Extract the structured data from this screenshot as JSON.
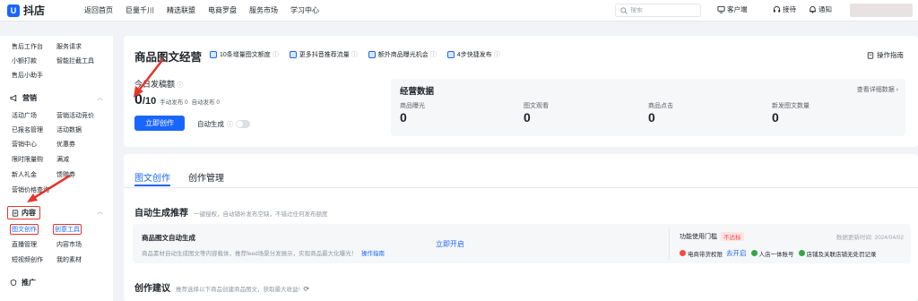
{
  "brand": {
    "logo_glyph": "U",
    "name": "抖店"
  },
  "topnav": [
    "返回首页",
    "巨量千川",
    "精选联盟",
    "电商罗盘",
    "服务市场",
    "学习中心"
  ],
  "search": {
    "placeholder": "搜索"
  },
  "toolbar": {
    "service": "客户端",
    "support": "接待",
    "notify": "通知"
  },
  "sidebar": {
    "top_rows": [
      [
        "售后工作台",
        "服务请求"
      ],
      [
        "小额打款",
        "智能拦截工具"
      ],
      [
        "售后小助手",
        ""
      ]
    ],
    "marketing": {
      "title": "营销",
      "rows": [
        [
          "活动广场",
          "营销活动竞价"
        ],
        [
          "已报名管理",
          "活动数据"
        ],
        [
          "营销中心",
          "优惠券"
        ],
        [
          "限时限量购",
          "满减"
        ],
        [
          "新人礼金",
          "馈赠券"
        ],
        [
          "营销价格查询",
          ""
        ]
      ]
    },
    "content": {
      "title": "内容",
      "rows": [
        [
          "图文创作",
          "创意工具"
        ],
        [
          "直播管理",
          "内容市场"
        ],
        [
          "短视频创作",
          "我的素材"
        ]
      ]
    },
    "promo": {
      "title": "推广"
    }
  },
  "header": {
    "title": "商品图文经营",
    "badges": [
      "10条增量图文额度",
      "更多抖音推荐流量",
      "额外商品曝光机会",
      "4步快捷发布"
    ],
    "guide": "操作指南"
  },
  "quota": {
    "label": "今日发稿额",
    "used": "0",
    "total": "/10",
    "manual": "手动发布 0",
    "auto": "自动发布 0",
    "create_btn": "立即创作",
    "auto_gen": "自动生成"
  },
  "business": {
    "title": "经营数据",
    "more": "查看详细数据",
    "metrics": [
      {
        "label": "商品曝光",
        "value": "0"
      },
      {
        "label": "图文观看",
        "value": "0"
      },
      {
        "label": "商品点击",
        "value": "0"
      },
      {
        "label": "新发图文数量",
        "value": "0"
      }
    ]
  },
  "tabs": {
    "active": "图文创作",
    "other": "创作管理"
  },
  "auto_section": {
    "title": "自动生成推荐",
    "desc": "一键授权，自动铺补发布空缺，不错过任何发布额度",
    "card_title": "商品图文自动生成",
    "card_desc": "商品素材自动生成图文等内容载体，推荐feed场景分发展示，实现商品最大化曝光！",
    "card_guide": "操作指南",
    "open_link": "立即开启",
    "threshold_label": "功能使用门槛",
    "threshold_status": "不达标",
    "update_time": "数据更新时间: 2024/04/02",
    "checks": [
      {
        "text": "电商带货权限",
        "ok": false,
        "action": "去开启"
      },
      {
        "text": "人店一体账号",
        "ok": true,
        "action": ""
      },
      {
        "text": "店铺及关联店铺无处罚记录",
        "ok": true,
        "action": ""
      }
    ]
  },
  "suggest": {
    "title": "创作建议",
    "desc": "推荐选择以下商品创建商品图文，获取最大收益!"
  },
  "colors": {
    "accent": "#1966ff",
    "annotation": "#e6352b",
    "danger": "#f54a45",
    "success": "#32a645"
  }
}
